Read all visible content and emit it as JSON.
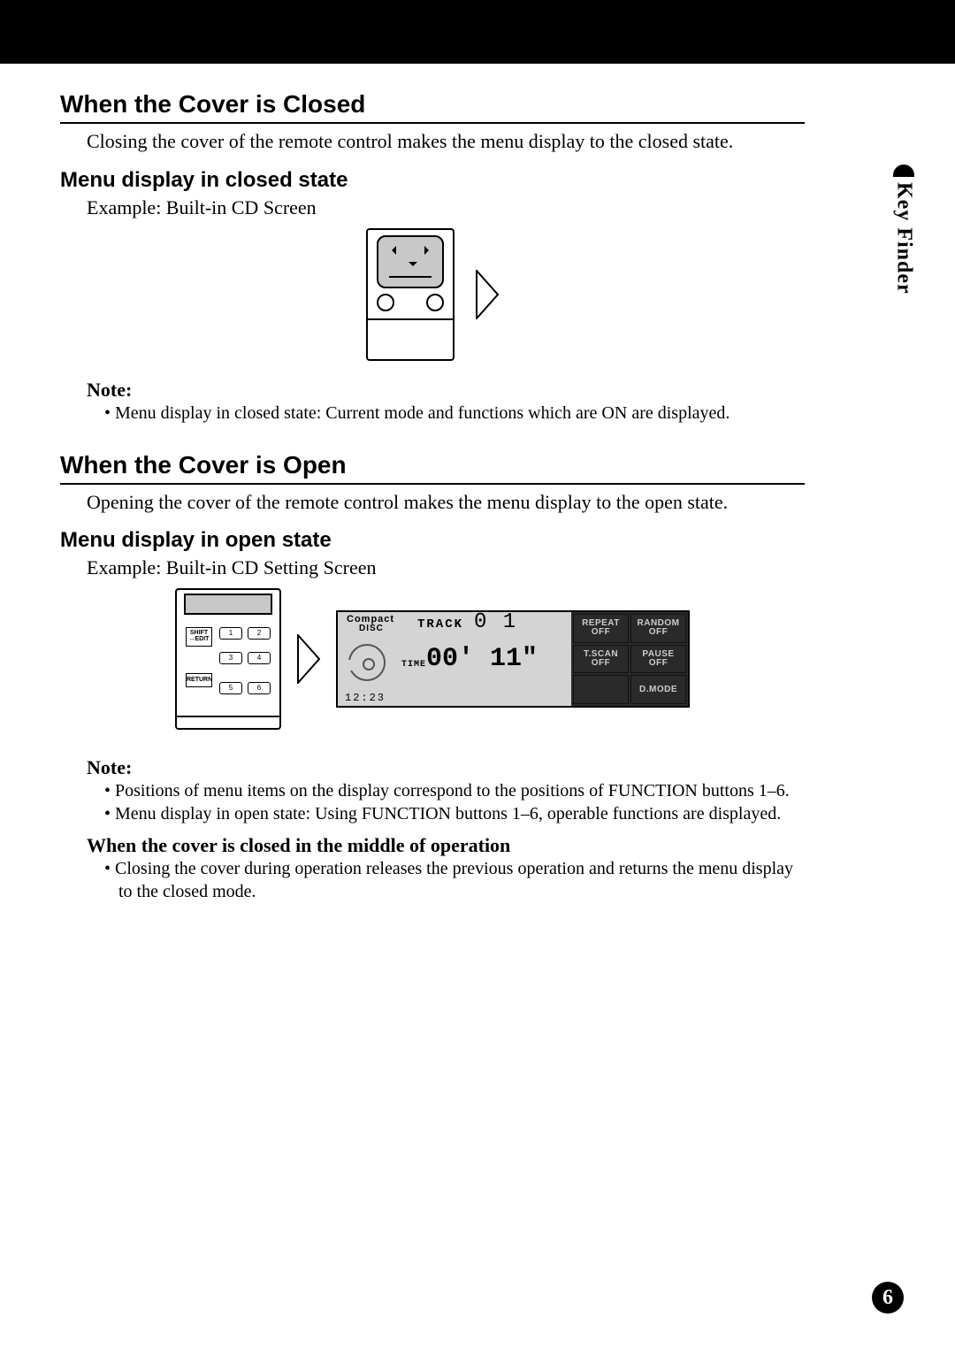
{
  "sidebar": {
    "tab": "Key Finder"
  },
  "page_number": "6",
  "closed": {
    "heading": "When the Cover is Closed",
    "para": "Closing the cover of the remote control makes the menu display to the closed state.",
    "subhead": "Menu display in closed state",
    "example": "Example: Built-in CD Screen",
    "note_label": "Note:",
    "note1": "Menu display in closed state: Current mode and functions which are ON are displayed."
  },
  "open": {
    "heading": "When the Cover is Open",
    "para": "Opening the cover of the remote control makes the menu display to the open state.",
    "subhead": "Menu display in open state",
    "example": "Example: Built-in CD Setting Screen",
    "note_label": "Note:",
    "note1": "Positions of menu items on the display correspond to the positions of FUNCTION buttons 1–6.",
    "note2": "Menu display in open state: Using FUNCTION buttons 1–6, operable functions are displayed.",
    "mid_head": "When the cover is closed in the middle of operation",
    "mid_note": "Closing the cover during operation releases the previous operation and returns the menu display to the closed mode."
  },
  "remote_open": {
    "shift": "SHIFT\n↔EDIT",
    "return": "RETURN",
    "b1": "1",
    "b2": "2",
    "b3": "3",
    "b4": "4",
    "b5": "5",
    "b6": "6"
  },
  "lcd": {
    "compact1": "Compact",
    "compact2": "DISC",
    "track_label": "TRACK",
    "track_num": "0 1",
    "time_label": "TIME",
    "time_val": "00' 11\"",
    "clock": "12:23",
    "cells": {
      "repeat": {
        "l1": "REPEAT",
        "l2": "OFF"
      },
      "random": {
        "l1": "RANDOM",
        "l2": "OFF"
      },
      "tscan": {
        "l1": "T.SCAN",
        "l2": "OFF"
      },
      "pause": {
        "l1": "PAUSE",
        "l2": "OFF"
      },
      "dmode": {
        "l1": "D.MODE"
      }
    }
  }
}
